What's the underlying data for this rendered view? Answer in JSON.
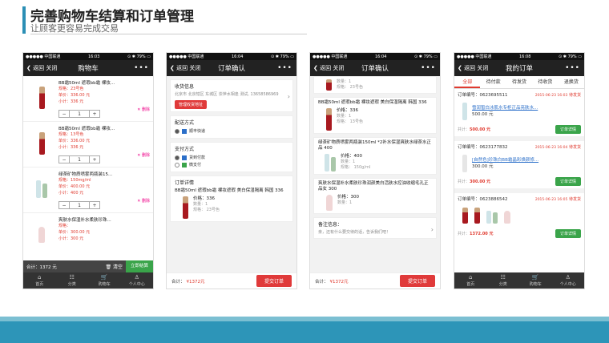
{
  "slide": {
    "title": "完善购物车结算和订单管理",
    "subtitle": "让顾客更容易完成交易"
  },
  "status": {
    "carrier": "●●●●● 中国联通",
    "wifi": "令",
    "battery": "⊙ ✱ 79% ▭",
    "time1": "16:03",
    "time2": "16:04",
    "time3": "16:04",
    "time4": "16:08"
  },
  "cart": {
    "back": "❮ 返回  关闭",
    "title": "购物车",
    "more": "•••",
    "items": [
      {
        "name": "BB霜50ml 遮瑕bb霜 裸妆...",
        "spec": "规格：23号色",
        "price": "单价：336.00 元",
        "subtotal": "小计：336 元",
        "qty": "1"
      },
      {
        "name": "BB霜50ml 遮瑕bb霜 裸妆...",
        "spec": "规格：13号色",
        "price": "单价：336.00 元",
        "subtotal": "小计：336 元",
        "qty": "1"
      },
      {
        "name": "绿茶矿物质喷雾两瓶装15...",
        "spec": "规格：150mg/ml",
        "price": "单价：400.00 元",
        "subtotal": "小计：400 元",
        "qty": "1"
      },
      {
        "name": "爽肤水保湿补水柔肤珍珠...",
        "spec": "规格：",
        "price": "单价：300.00 元",
        "subtotal": "小计：300 元",
        "qty": "1"
      }
    ],
    "del": "✕ 删除",
    "total": "合计：1372 元",
    "clear": "🗑 清空",
    "checkout": "立即结算"
  },
  "tabbar": [
    {
      "icon": "⌂",
      "label": "首页"
    },
    {
      "icon": "☷",
      "label": "分类"
    },
    {
      "icon": "🛒",
      "label": "购物车"
    },
    {
      "icon": "♙",
      "label": "个人中心"
    }
  ],
  "confirm": {
    "back": "❮ 返回  关闭",
    "title": "订单确认",
    "more": "•••",
    "recv_title": "收货信息",
    "address": "北京市 北京辖区 东城区 崇萍水相逢 测试, 13658586969",
    "manage_addr": "管理收货地址",
    "ship_title": "配送方式",
    "ship_opt": "顺丰快递",
    "pay_title": "支付方式",
    "pay_opt1": "货到付款",
    "pay_opt2": "微支付",
    "detail_title": "订单详情",
    "prod_name": "BB霜50ml 遮瑕bb霜 裸妆遮瑕 美白保湿隔离 韩国 336",
    "prod_price": "价格：336",
    "prod_qty": "数量：1",
    "prod_spec": "规格：   23号色",
    "total_label": "合计：",
    "total_value": "¥1372元",
    "submit": "提交订单"
  },
  "confirm2": {
    "back": "❮ 返回  关闭",
    "title": "订单确认",
    "more": "•••",
    "top_qty": "数量：1",
    "top_spec": "规格：   23号色",
    "p1_name": "BB霜50ml 遮瑕bb霜 裸妆遮瑕 美白保湿隔离 韩国 336",
    "p1_price": "价格：336",
    "p1_qty": "数量：1",
    "p1_spec": "规格：   13号色",
    "p2_name": "绿茶矿物质喷雾两瓶装150ml *2补水保湿爽肤水绿茶水正品 400",
    "p2_price": "价格：400",
    "p2_qty": "数量：1",
    "p2_spec": "规格：   150g/ml",
    "p3_name": "爽肤水保湿补水柔肤珍珠润颜美白活肤水控油收缩毛孔正品女 300",
    "p3_price": "价格：300",
    "p3_qty": "数量：1",
    "note_title": "备注信息：",
    "note_ph": "亲，还有什么要交待的话，告诉我们吧！",
    "total_label": "合计：",
    "total_value": "¥1372元",
    "submit": "提交订单"
  },
  "orders": {
    "back": "❮ 返回  关闭",
    "title": "我的订单",
    "more": "•••",
    "tabs": [
      "全部",
      "待付款",
      "待发货",
      "待收货",
      "退换货"
    ],
    "list": [
      {
        "no": "订单编号：0623695511",
        "time": "2015-06-23 16:03",
        "status": "待发货",
        "desc": "雪润皙白冰肌水专柜正品亮肤水...",
        "price": "500.00 元",
        "total_label": "共计：",
        "total": "500.00 元",
        "btn": "订单详情"
      },
      {
        "no": "订单编号：0623177832",
        "time": "2015-06-23 16:04",
        "status": "待发货",
        "desc": "[自然色]珍珠白BB霜晶彩焕颜修...",
        "price": "300.00 元",
        "total_label": "共计：",
        "total": "300.00 元",
        "btn": "订单详情"
      },
      {
        "no": "订单编号：0623886542",
        "time": "2015-06-23 16:05",
        "status": "待发货",
        "total_label": "共计：",
        "total": "1372.00 元",
        "btn": "订单详情"
      }
    ]
  }
}
